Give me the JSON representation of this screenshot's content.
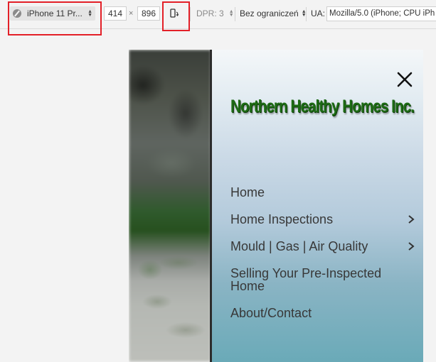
{
  "toolbar": {
    "device": "iPhone 11 Pr...",
    "width": "414",
    "times": "×",
    "height": "896",
    "dpr": "DPR: 3",
    "throttle": "Bez ograniczeń",
    "ua_label": "UA:",
    "ua_value": "Mozilla/5.0 (iPhone; CPU iPh"
  },
  "page": {
    "logo": "Northern Healthy Homes Inc.",
    "nav": [
      {
        "label": "Home"
      },
      {
        "label": "Home Inspections"
      },
      {
        "label": "Mould | Gas | Air Quality"
      },
      {
        "label": "Selling Your Pre-Inspected Home"
      },
      {
        "label": "About/Contact"
      }
    ]
  },
  "colors": {
    "highlight": "#e32028",
    "logo": "#1d6b14",
    "nav_text": "#383838"
  }
}
